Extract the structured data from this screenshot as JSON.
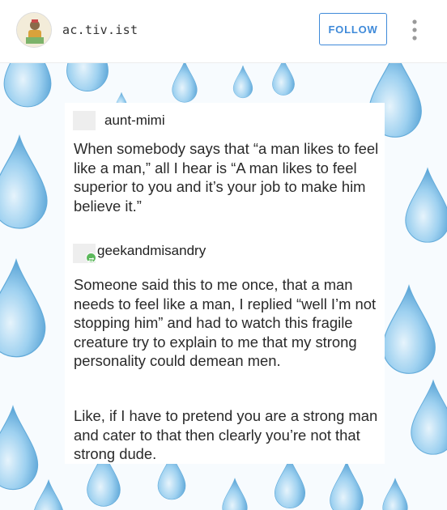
{
  "header": {
    "handle": "ac.tiv.ist",
    "follow_label": "FOLLOW",
    "avatar_icon": "avatar-icon",
    "more_icon": "more-vertical-icon",
    "accent_color": "#3f8ad9"
  },
  "post": {
    "user1": "aunt-mimi",
    "text1": "When somebody says that “a man likes to feel like a man,” all I hear is “A man likes to feel superior to you and it’s your job to make him believe it.”",
    "user2": "geekandmisandry",
    "text2": "Someone said this to me once, that a man needs to feel like a man, I replied “well I’m not stopping him” and had to watch this fragile creature try to explain to me that my strong personality could demean men.",
    "text3": "Like, if I have to pretend you are a strong man and cater to that then clearly you’re not that strong dude.",
    "background": "watercolor-raindrops",
    "drop_color": "#5aa9dc"
  }
}
